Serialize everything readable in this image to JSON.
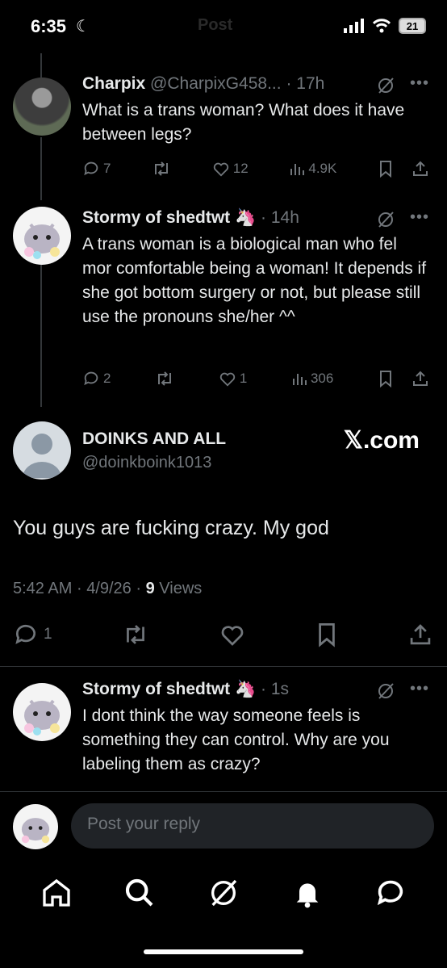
{
  "status_bar": {
    "time": "6:35",
    "ghost_title": "Post",
    "battery": "21"
  },
  "tweets": [
    {
      "name": "Charpix",
      "handle": "@CharpixG458...",
      "sep": "·",
      "time": "17h",
      "text": "What is a trans woman? What does it have between legs?",
      "replies": "7",
      "likes": "12",
      "views": "4.9K"
    },
    {
      "name": "Stormy of shedtwt",
      "emoji": "🦄",
      "sep": "·",
      "time": "14h",
      "text": "A trans woman is a biological man who fel mor comfortable being a woman! It depends if she got bottom surgery or not, but please still use the pronouns she/her ^^",
      "replies": "2",
      "likes": "1",
      "views": "306"
    }
  ],
  "main_post": {
    "name": "DOINKS AND ALL",
    "handle": "@doinkboink1013",
    "brand": "𝕏.com",
    "text": "You guys are fucking crazy. My god",
    "time": "5:42 AM",
    "date": "4/9/26",
    "views_count": "9",
    "views_label": "Views",
    "sep": "·",
    "replies": "1"
  },
  "reply": {
    "name": "Stormy of shedtwt",
    "emoji": "🦄",
    "sep": "·",
    "time": "1s",
    "text": "I dont think the way someone feels is something they can control. Why are you labeling them as crazy?"
  },
  "compose": {
    "placeholder": "Post your reply"
  },
  "nav": [
    "home-icon",
    "search-icon",
    "grok-icon",
    "notifications-icon",
    "messages-icon"
  ],
  "colors": {
    "background": "#000000",
    "text": "#e7e9ea",
    "muted": "#71767b"
  }
}
